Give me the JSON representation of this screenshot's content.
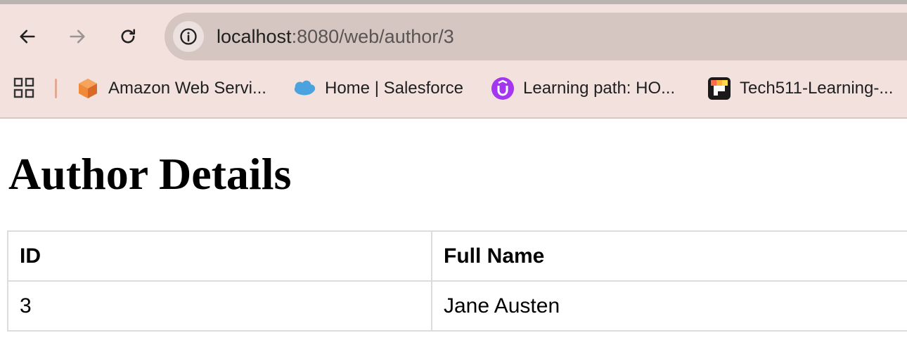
{
  "browser": {
    "address_bar": {
      "host": "localhost",
      "path": ":8080/web/author/3"
    },
    "bookmarks": [
      {
        "label": "Amazon Web Servi...",
        "icon": "aws-cube-icon"
      },
      {
        "label": "Home | Salesforce",
        "icon": "salesforce-cloud-icon"
      },
      {
        "label": "Learning path: HO...",
        "icon": "udemy-u-icon"
      },
      {
        "label": "Tech511-Learning-...",
        "icon": "tech511-logo-icon"
      }
    ]
  },
  "page": {
    "title": "Author Details",
    "table": {
      "headers": [
        "ID",
        "Full Name"
      ],
      "rows": [
        [
          "3",
          "Jane Austen"
        ]
      ]
    }
  },
  "colors": {
    "chrome_bg": "#f2e1dc",
    "omnibox_bg": "#d5c6c2",
    "table_border": "#dcdcdc",
    "udemy_purple": "#a435f0",
    "salesforce_blue": "#4aa3df",
    "aws_orange": "#f08a38"
  }
}
